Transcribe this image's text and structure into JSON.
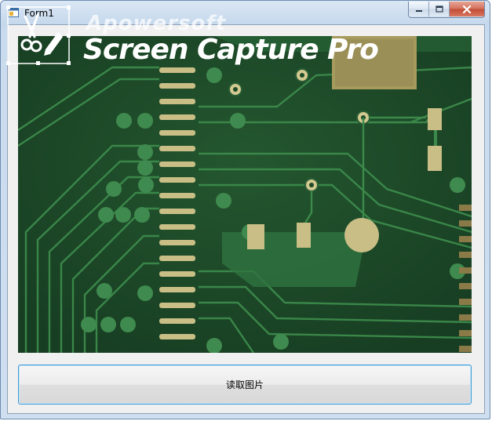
{
  "window": {
    "title": "Form1",
    "caption_buttons": {
      "minimize": "minimize-icon",
      "maximize": "maximize-icon",
      "close": "close-icon"
    }
  },
  "main": {
    "picture_description_icon": "pcb-image",
    "read_button_label": "读取图片"
  },
  "watermark": {
    "brand": "Apowersoft",
    "product": "Screen Capture Pro"
  },
  "colors": {
    "pcb_base": "#1f4a2a",
    "trace": "#3f8a4e",
    "pad": "#c9bf86",
    "button_border": "#3c9ad8"
  }
}
